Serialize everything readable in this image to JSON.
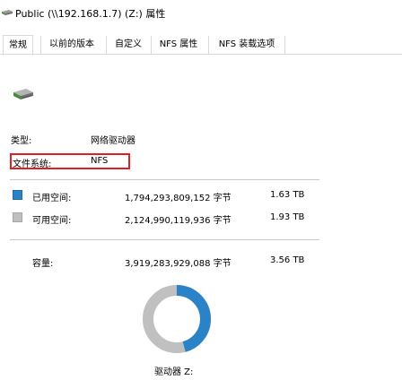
{
  "window": {
    "title": "Public (\\\\192.168.1.7) (Z:) 属性"
  },
  "tabs": [
    {
      "label": "常规",
      "active": true
    },
    {
      "label": "以前的版本",
      "active": false
    },
    {
      "label": "自定义",
      "active": false
    },
    {
      "label": "NFS 属性",
      "active": false
    },
    {
      "label": "NFS 装载选项",
      "active": false
    }
  ],
  "general": {
    "type_label": "类型:",
    "type_value": "网络驱动器",
    "filesystem_label": "文件系统:",
    "filesystem_value": "NFS",
    "used": {
      "label": "已用空间:",
      "bytes": "1,794,293,809,152 字节",
      "size": "1.63 TB"
    },
    "free": {
      "label": "可用空间:",
      "bytes": "2,124,990,119,936 字节",
      "size": "1.93 TB"
    },
    "capacity": {
      "label": "容量:",
      "bytes": "3,919,283,929,088 字节",
      "size": "3.56 TB"
    },
    "drive_caption": "驱动器 Z:"
  },
  "usage_chart": {
    "used_fraction": 0.4578,
    "used_color": "#2a83c6",
    "free_color": "#c0c0c0"
  },
  "icons": {
    "title_icon": "network-drive-icon",
    "drive_icon": "network-drive-icon"
  }
}
